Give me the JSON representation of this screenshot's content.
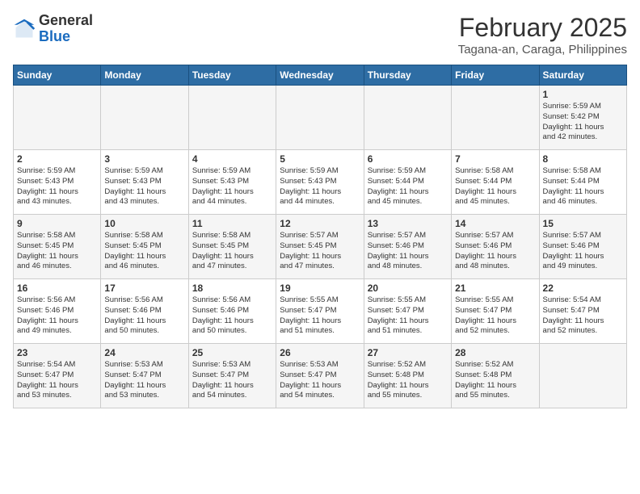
{
  "header": {
    "logo_general": "General",
    "logo_blue": "Blue",
    "title": "February 2025",
    "subtitle": "Tagana-an, Caraga, Philippines"
  },
  "weekdays": [
    "Sunday",
    "Monday",
    "Tuesday",
    "Wednesday",
    "Thursday",
    "Friday",
    "Saturday"
  ],
  "weeks": [
    [
      {
        "day": "",
        "info": ""
      },
      {
        "day": "",
        "info": ""
      },
      {
        "day": "",
        "info": ""
      },
      {
        "day": "",
        "info": ""
      },
      {
        "day": "",
        "info": ""
      },
      {
        "day": "",
        "info": ""
      },
      {
        "day": "1",
        "info": "Sunrise: 5:59 AM\nSunset: 5:42 PM\nDaylight: 11 hours\nand 42 minutes."
      }
    ],
    [
      {
        "day": "2",
        "info": "Sunrise: 5:59 AM\nSunset: 5:43 PM\nDaylight: 11 hours\nand 43 minutes."
      },
      {
        "day": "3",
        "info": "Sunrise: 5:59 AM\nSunset: 5:43 PM\nDaylight: 11 hours\nand 43 minutes."
      },
      {
        "day": "4",
        "info": "Sunrise: 5:59 AM\nSunset: 5:43 PM\nDaylight: 11 hours\nand 44 minutes."
      },
      {
        "day": "5",
        "info": "Sunrise: 5:59 AM\nSunset: 5:43 PM\nDaylight: 11 hours\nand 44 minutes."
      },
      {
        "day": "6",
        "info": "Sunrise: 5:59 AM\nSunset: 5:44 PM\nDaylight: 11 hours\nand 45 minutes."
      },
      {
        "day": "7",
        "info": "Sunrise: 5:58 AM\nSunset: 5:44 PM\nDaylight: 11 hours\nand 45 minutes."
      },
      {
        "day": "8",
        "info": "Sunrise: 5:58 AM\nSunset: 5:44 PM\nDaylight: 11 hours\nand 46 minutes."
      }
    ],
    [
      {
        "day": "9",
        "info": "Sunrise: 5:58 AM\nSunset: 5:45 PM\nDaylight: 11 hours\nand 46 minutes."
      },
      {
        "day": "10",
        "info": "Sunrise: 5:58 AM\nSunset: 5:45 PM\nDaylight: 11 hours\nand 46 minutes."
      },
      {
        "day": "11",
        "info": "Sunrise: 5:58 AM\nSunset: 5:45 PM\nDaylight: 11 hours\nand 47 minutes."
      },
      {
        "day": "12",
        "info": "Sunrise: 5:57 AM\nSunset: 5:45 PM\nDaylight: 11 hours\nand 47 minutes."
      },
      {
        "day": "13",
        "info": "Sunrise: 5:57 AM\nSunset: 5:46 PM\nDaylight: 11 hours\nand 48 minutes."
      },
      {
        "day": "14",
        "info": "Sunrise: 5:57 AM\nSunset: 5:46 PM\nDaylight: 11 hours\nand 48 minutes."
      },
      {
        "day": "15",
        "info": "Sunrise: 5:57 AM\nSunset: 5:46 PM\nDaylight: 11 hours\nand 49 minutes."
      }
    ],
    [
      {
        "day": "16",
        "info": "Sunrise: 5:56 AM\nSunset: 5:46 PM\nDaylight: 11 hours\nand 49 minutes."
      },
      {
        "day": "17",
        "info": "Sunrise: 5:56 AM\nSunset: 5:46 PM\nDaylight: 11 hours\nand 50 minutes."
      },
      {
        "day": "18",
        "info": "Sunrise: 5:56 AM\nSunset: 5:46 PM\nDaylight: 11 hours\nand 50 minutes."
      },
      {
        "day": "19",
        "info": "Sunrise: 5:55 AM\nSunset: 5:47 PM\nDaylight: 11 hours\nand 51 minutes."
      },
      {
        "day": "20",
        "info": "Sunrise: 5:55 AM\nSunset: 5:47 PM\nDaylight: 11 hours\nand 51 minutes."
      },
      {
        "day": "21",
        "info": "Sunrise: 5:55 AM\nSunset: 5:47 PM\nDaylight: 11 hours\nand 52 minutes."
      },
      {
        "day": "22",
        "info": "Sunrise: 5:54 AM\nSunset: 5:47 PM\nDaylight: 11 hours\nand 52 minutes."
      }
    ],
    [
      {
        "day": "23",
        "info": "Sunrise: 5:54 AM\nSunset: 5:47 PM\nDaylight: 11 hours\nand 53 minutes."
      },
      {
        "day": "24",
        "info": "Sunrise: 5:53 AM\nSunset: 5:47 PM\nDaylight: 11 hours\nand 53 minutes."
      },
      {
        "day": "25",
        "info": "Sunrise: 5:53 AM\nSunset: 5:47 PM\nDaylight: 11 hours\nand 54 minutes."
      },
      {
        "day": "26",
        "info": "Sunrise: 5:53 AM\nSunset: 5:47 PM\nDaylight: 11 hours\nand 54 minutes."
      },
      {
        "day": "27",
        "info": "Sunrise: 5:52 AM\nSunset: 5:48 PM\nDaylight: 11 hours\nand 55 minutes."
      },
      {
        "day": "28",
        "info": "Sunrise: 5:52 AM\nSunset: 5:48 PM\nDaylight: 11 hours\nand 55 minutes."
      },
      {
        "day": "",
        "info": ""
      }
    ]
  ]
}
